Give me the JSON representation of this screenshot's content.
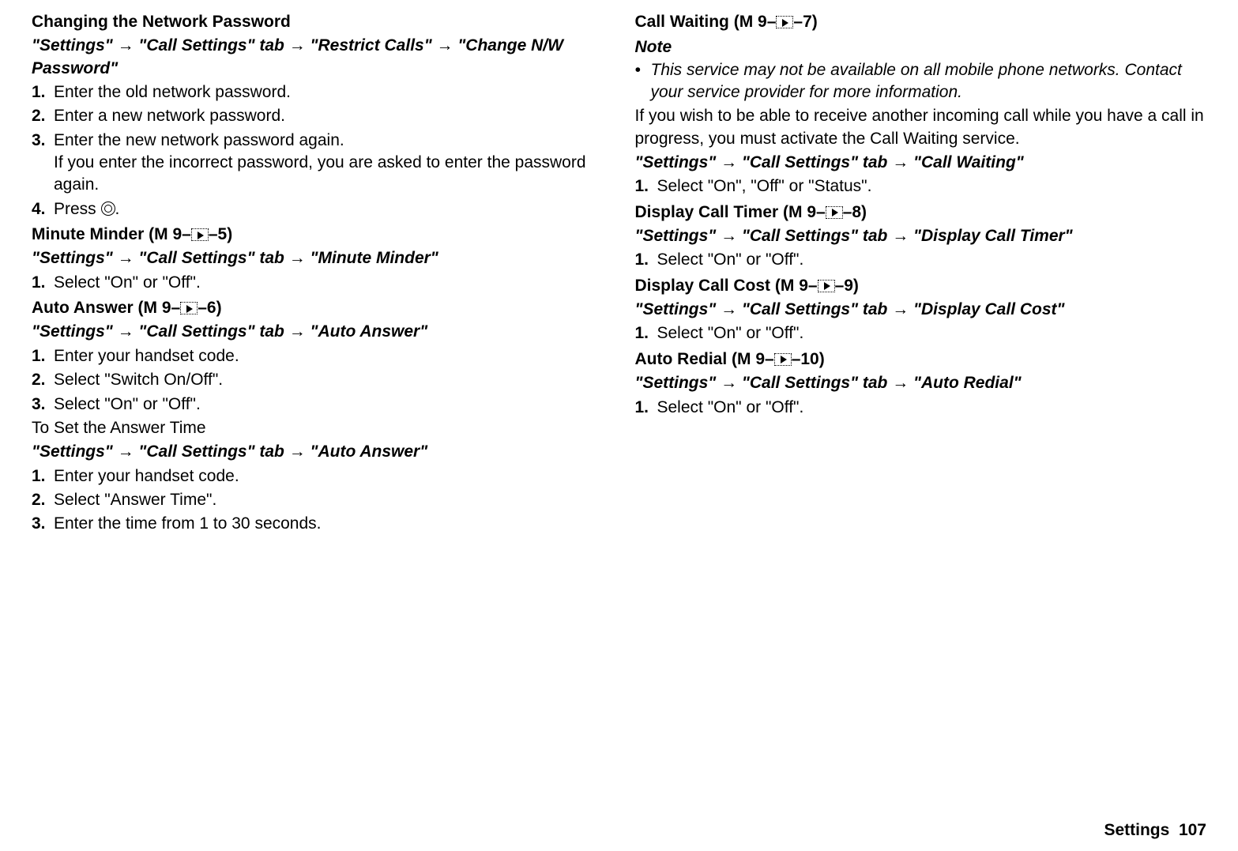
{
  "left": {
    "sec1": {
      "heading": "Changing the Network Password",
      "path": "\"Settings\" → \"Call Settings\" tab → \"Restrict Calls\" → \"Change N/W Password\"",
      "steps": [
        "Enter the old network password.",
        "Enter a new network password.",
        "Enter the new network password again.",
        "Press "
      ],
      "step3_sub": "If you enter the incorrect password, you are asked to enter the password again.",
      "step4_post": "."
    },
    "sec2": {
      "heading_pre": "Minute Minder (M 9–",
      "heading_post": "–5)",
      "path": "\"Settings\" → \"Call Settings\" tab → \"Minute Minder\"",
      "steps": [
        "Select \"On\" or \"Off\"."
      ]
    },
    "sec3": {
      "heading_pre": "Auto Answer (M 9–",
      "heading_post": "–6)",
      "path": "\"Settings\" → \"Call Settings\" tab → \"Auto Answer\"",
      "steps": [
        "Enter your handset code.",
        "Select \"Switch On/Off\".",
        "Select \"On\" or \"Off\"."
      ],
      "sub_head": "To Set the Answer Time",
      "path2": "\"Settings\" → \"Call Settings\" tab → \"Auto Answer\"",
      "steps2": [
        "Enter your handset code.",
        "Select \"Answer Time\".",
        "Enter the time from 1 to 30 seconds."
      ]
    }
  },
  "right": {
    "sec1": {
      "heading_pre": "Call Waiting (M 9–",
      "heading_post": "–7)",
      "note_head": "Note",
      "note_text": "This service may not be available on all mobile phone networks. Contact your service provider for more information.",
      "body": "If you wish to be able to receive another incoming call while you have a call in progress, you must activate the Call Waiting service.",
      "path": "\"Settings\" → \"Call Settings\" tab → \"Call Waiting\"",
      "steps": [
        "Select \"On\", \"Off\" or \"Status\"."
      ]
    },
    "sec2": {
      "heading_pre": "Display Call Timer (M 9–",
      "heading_post": "–8)",
      "path": "\"Settings\" → \"Call Settings\" tab → \"Display Call Timer\"",
      "steps": [
        "Select \"On\" or \"Off\"."
      ]
    },
    "sec3": {
      "heading_pre": "Display Call Cost (M 9–",
      "heading_post": "–9)",
      "path": "\"Settings\" → \"Call Settings\" tab → \"Display Call Cost\"",
      "steps": [
        "Select \"On\" or \"Off\"."
      ]
    },
    "sec4": {
      "heading_pre": "Auto Redial (M 9–",
      "heading_post": "–10)",
      "path": "\"Settings\" → \"Call Settings\" tab → \"Auto Redial\"",
      "steps": [
        "Select \"On\" or \"Off\"."
      ]
    }
  },
  "footer": {
    "label": "Settings",
    "page": "107"
  }
}
